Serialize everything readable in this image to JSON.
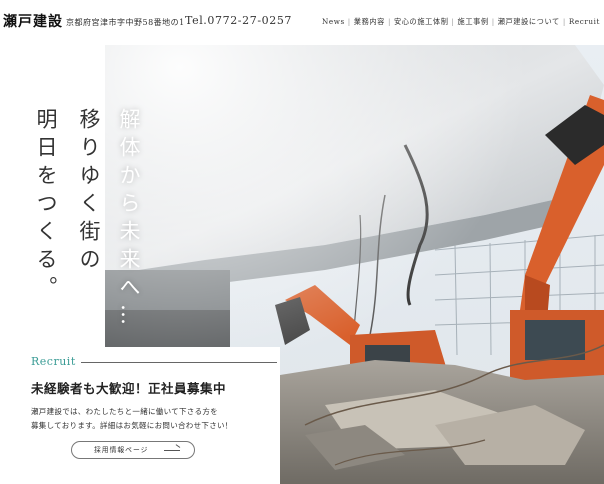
{
  "header": {
    "logo": "瀬戸建設",
    "address": "京都府宮津市字中野58番地の1",
    "tel": "Tel.0772-27-0257",
    "nav": [
      "News",
      "業務内容",
      "安心の施工体制",
      "施工事例",
      "瀬戸建設について",
      "Recruit"
    ]
  },
  "hero": {
    "copy_right": "移りゆく街の",
    "copy_left": "明日をつくる。",
    "copy_white": "解体から未来へ…"
  },
  "recruit": {
    "label": "Recruit",
    "title": "未経験者も大歓迎！正社員募集中",
    "body_line1": "瀬戸建設では、わたしたちと一緒に働いて下さる方を",
    "body_line2": "募集しております。詳細はお気軽にお問い合わせ下さい！",
    "button": "採用情報ページ"
  },
  "colors": {
    "accent": "#3a9c95",
    "excavator": "#d9602c",
    "text": "#222222"
  }
}
